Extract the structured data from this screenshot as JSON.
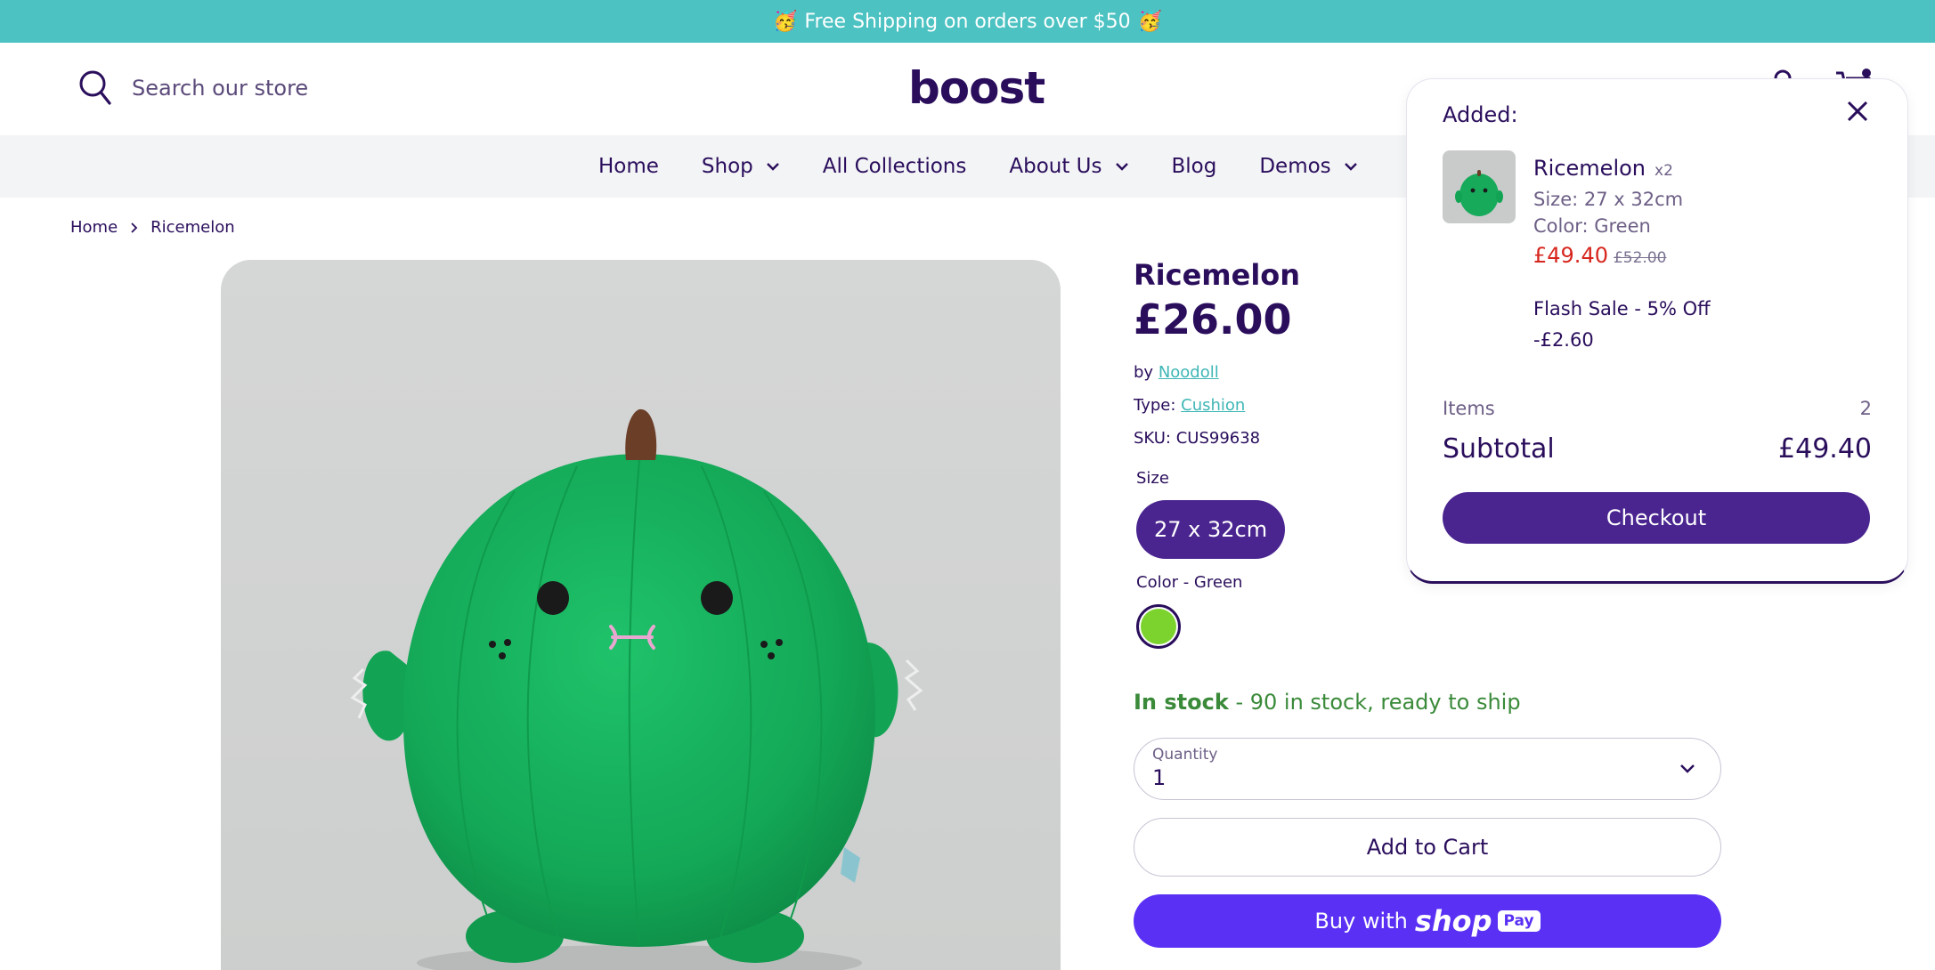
{
  "announcement": {
    "emoji_left": "🥳",
    "text": "Free Shipping on orders over $50",
    "emoji_right": "🥳"
  },
  "header": {
    "search_placeholder": "Search our store",
    "logo": "boost"
  },
  "nav": {
    "items": [
      {
        "label": "Home"
      },
      {
        "label": "Shop"
      },
      {
        "label": "All Collections"
      },
      {
        "label": "About Us"
      },
      {
        "label": "Blog"
      },
      {
        "label": "Demos"
      }
    ]
  },
  "breadcrumb": {
    "home": "Home",
    "current": "Ricemelon"
  },
  "product": {
    "title": "Ricemelon",
    "price": "£26.00",
    "by_label": "by",
    "vendor": "Noodoll",
    "type_label": "Type:",
    "type": "Cushion",
    "sku": "SKU: CUS99638",
    "size_label": "Size",
    "size_value": "27 x 32cm",
    "color_label": "Color - Green",
    "stock_strong": "In stock",
    "stock_rest": " - 90 in stock, ready to ship",
    "quantity_label": "Quantity",
    "quantity_value": "1",
    "add_to_cart": "Add to Cart",
    "buy_with": "Buy with",
    "shop_word": "shop",
    "pay_word": "Pay"
  },
  "colors": {
    "brand": "#2a0e5c",
    "accent_purple": "#4a2590",
    "teal": "#4dc2c2",
    "swatch_green": "#7cd32e",
    "stock_green": "#3a8a3a",
    "sale_red": "#d7261e",
    "shop_pay": "#5a31f4"
  },
  "cart_popup": {
    "added_label": "Added:",
    "item_name": "Ricemelon",
    "item_qty": "x2",
    "item_size": "Size: 27 x 32cm",
    "item_color": "Color: Green",
    "item_price": "£49.40",
    "item_old_price": "£52.00",
    "discount_name": "Flash Sale - 5% Off",
    "discount_amount": "-£2.60",
    "items_label": "Items",
    "items_count": "2",
    "subtotal_label": "Subtotal",
    "subtotal_value": "£49.40",
    "checkout": "Checkout"
  },
  "icons": [
    "search-icon",
    "account-icon",
    "cart-icon",
    "chevron-down-icon",
    "chevron-right-icon",
    "close-icon"
  ]
}
